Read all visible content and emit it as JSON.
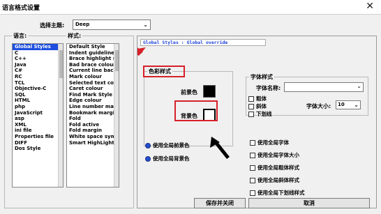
{
  "window": {
    "title": "语言格式设置",
    "close_glyph": "✕"
  },
  "theme": {
    "label": "选择主题:",
    "value": "Deep",
    "arrow": "⌄"
  },
  "languages": {
    "title": "语言:",
    "items": [
      "Global Styles",
      "C",
      "C++",
      "Java",
      "C#",
      "RC",
      "TCL",
      "Objective-C",
      "SQL",
      "HTML",
      "php",
      "JavaScript",
      "asp",
      "XML",
      "ini file",
      "Properties file",
      "DIFF",
      "Dos Style"
    ],
    "selected_index": 0
  },
  "styles": {
    "title": "样式:",
    "items": [
      "Default Style",
      "Indent guideline style",
      "Brace highlight style",
      "Bad brace colour",
      "Current line background",
      "Mark colour",
      "Selected text colour",
      "Caret colour",
      "Find Mark Style",
      "Edge colour",
      "Line number margin",
      "Bookmark margin",
      "Fold",
      "Fold active",
      "Fold margin",
      "White space symbol",
      "Smart HighLighting"
    ]
  },
  "description": "Global Styles : Global override",
  "colour_style": {
    "title": "色彩样式",
    "fg_label": "前景色",
    "bg_label": "背景色",
    "fg_color": "#000000",
    "bg_color": "#ffffff"
  },
  "font_style": {
    "title": "字体样式",
    "name_label": "字体名称:",
    "name_value": "",
    "bold": "粗体",
    "italic": "斜体",
    "underline": "下划线",
    "size_label": "字体大小:",
    "size_value": "10"
  },
  "global_radios": {
    "fg": "使用全局前景色",
    "bg": "使用全局背景色"
  },
  "global_checks": [
    "使用全局字体",
    "使用全局字体大小",
    "使用全局粗体样式",
    "使用全局斜体样式",
    "使用全局下划线样式"
  ],
  "buttons": {
    "save_close": "保存并关闭",
    "cancel": "取消"
  },
  "annotation_color": "#d6202a"
}
